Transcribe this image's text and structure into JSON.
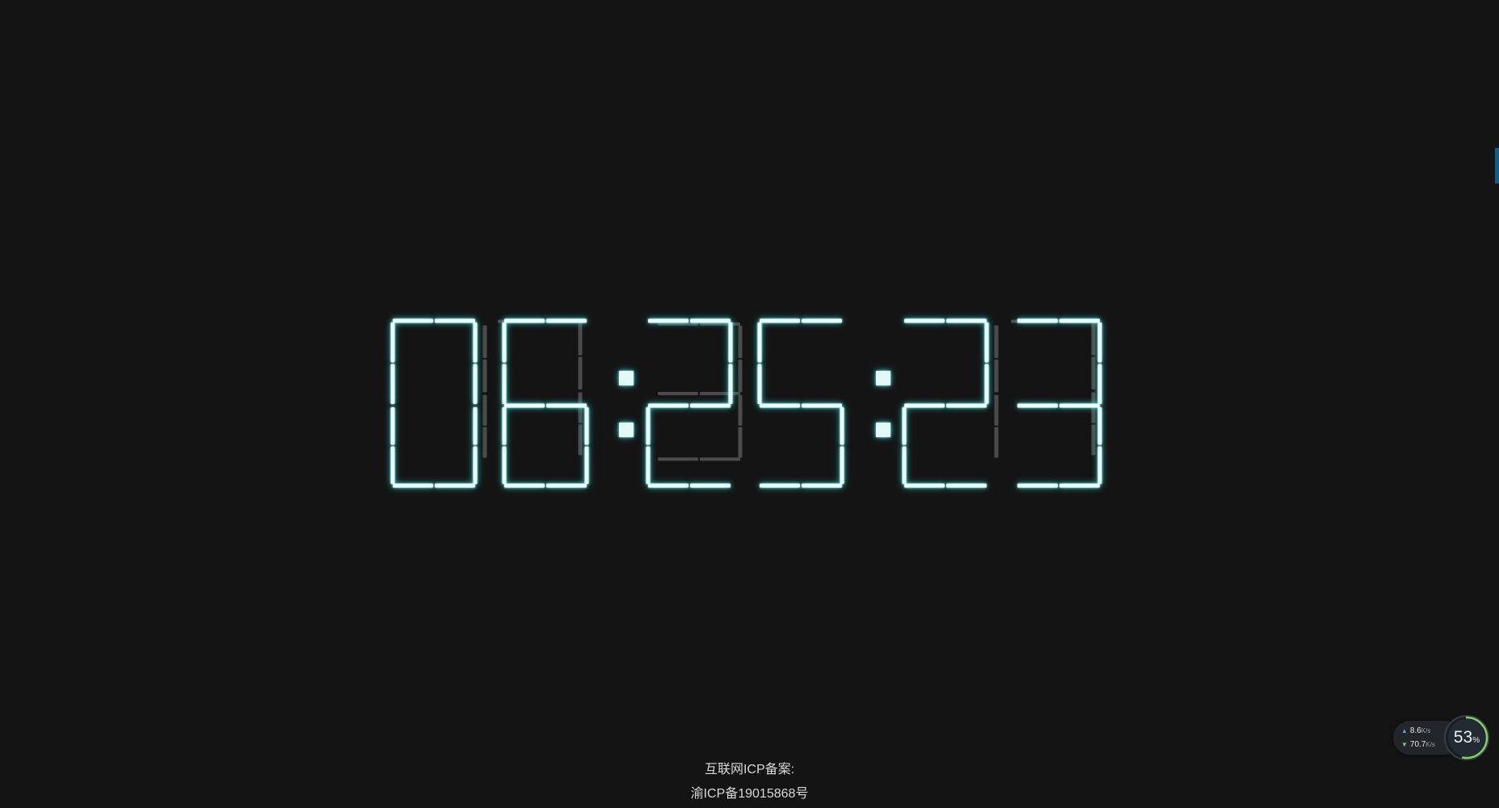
{
  "clock": {
    "time": "06:25:23",
    "ghost_time": "17:35:17",
    "digit_color": "#ecffff",
    "glow_color": "#2fd5d5",
    "ghost_color": "#6b6b6b",
    "background": "#141414"
  },
  "footer": {
    "line1": "互联网ICP备案:",
    "line2": "渝ICP备19015868号"
  },
  "network_widget": {
    "upload_value": "8.6",
    "upload_unit": "K/s",
    "download_value": "70.7",
    "download_unit": "K/s",
    "usage_value": "53",
    "usage_unit": "%",
    "usage_fraction": 0.53,
    "upload_icon": "arrow-up-icon",
    "download_icon": "arrow-down-icon"
  }
}
